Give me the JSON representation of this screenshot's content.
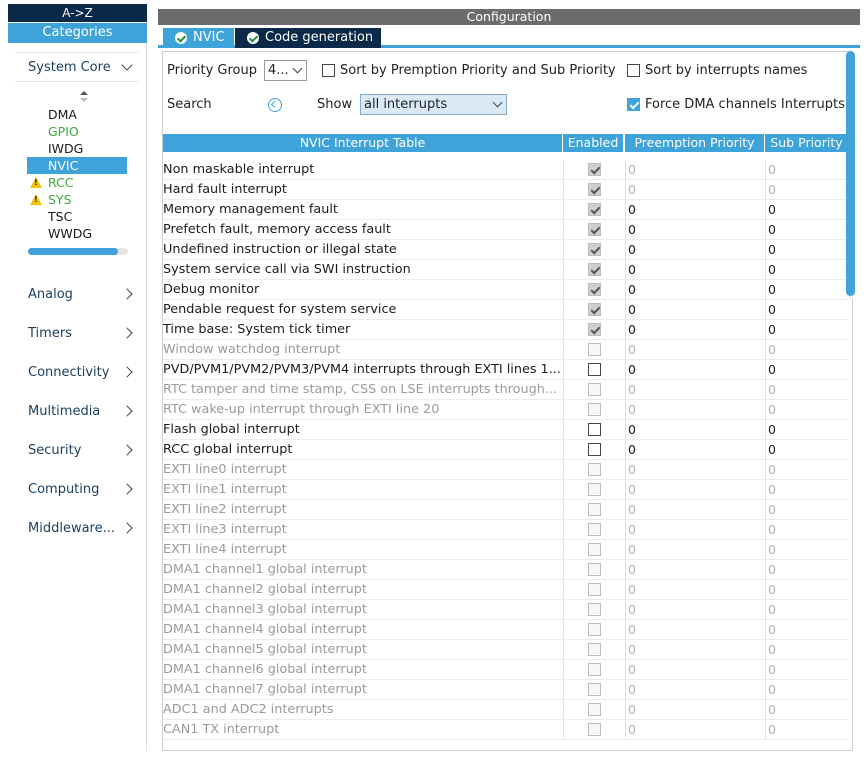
{
  "sidebar": {
    "tab_az": "A->Z",
    "tab_categories": "Categories",
    "system_core": {
      "label": "System Core",
      "items": [
        {
          "label": "DMA",
          "state": "normal"
        },
        {
          "label": "GPIO",
          "state": "configured"
        },
        {
          "label": "IWDG",
          "state": "normal"
        },
        {
          "label": "NVIC",
          "state": "selected"
        },
        {
          "label": "RCC",
          "state": "warning"
        },
        {
          "label": "SYS",
          "state": "warning"
        },
        {
          "label": "TSC",
          "state": "normal"
        },
        {
          "label": "WWDG",
          "state": "normal"
        }
      ]
    },
    "categories": [
      {
        "label": "Analog"
      },
      {
        "label": "Timers"
      },
      {
        "label": "Connectivity"
      },
      {
        "label": "Multimedia"
      },
      {
        "label": "Security"
      },
      {
        "label": "Computing"
      },
      {
        "label": "Middleware..."
      }
    ]
  },
  "main": {
    "title": "Configuration",
    "tabs": [
      {
        "label": "NVIC"
      },
      {
        "label": "Code generation"
      }
    ],
    "controls": {
      "priority_group_label": "Priority Group",
      "priority_group_value": "4...",
      "sort_premption_label": "Sort by Premption Priority and Sub Priority",
      "sort_premption_checked": false,
      "sort_names_label": "Sort by interrupts names",
      "sort_names_checked": false,
      "search_label": "Search",
      "show_label": "Show",
      "show_value": "all interrupts",
      "force_dma_label": "Force DMA channels Interrupts",
      "force_dma_checked": true
    },
    "table": {
      "headers": [
        "NVIC Interrupt Table",
        "Enabled",
        "Preemption Priority",
        "Sub Priority"
      ],
      "rows": [
        {
          "name": "Non maskable interrupt",
          "enabled": "locked",
          "preemption": "0",
          "sub": "0",
          "active": true,
          "pp_gray": true
        },
        {
          "name": "Hard fault interrupt",
          "enabled": "locked",
          "preemption": "0",
          "sub": "0",
          "active": true,
          "pp_gray": true
        },
        {
          "name": "Memory management fault",
          "enabled": "locked",
          "preemption": "0",
          "sub": "0",
          "active": true
        },
        {
          "name": "Prefetch fault, memory access fault",
          "enabled": "locked",
          "preemption": "0",
          "sub": "0",
          "active": true
        },
        {
          "name": "Undefined instruction or illegal state",
          "enabled": "locked",
          "preemption": "0",
          "sub": "0",
          "active": true
        },
        {
          "name": "System service call via SWI instruction",
          "enabled": "locked",
          "preemption": "0",
          "sub": "0",
          "active": true
        },
        {
          "name": "Debug monitor",
          "enabled": "locked",
          "preemption": "0",
          "sub": "0",
          "active": true
        },
        {
          "name": "Pendable request for system service",
          "enabled": "locked",
          "preemption": "0",
          "sub": "0",
          "active": true
        },
        {
          "name": "Time base: System tick timer",
          "enabled": "locked",
          "preemption": "0",
          "sub": "0",
          "active": true
        },
        {
          "name": "Window watchdog interrupt",
          "enabled": "disabled",
          "preemption": "0",
          "sub": "0",
          "active": false
        },
        {
          "name": "PVD/PVM1/PVM2/PVM3/PVM4 interrupts through EXTI lines 1...",
          "enabled": "off",
          "preemption": "0",
          "sub": "0",
          "active": true
        },
        {
          "name": "RTC tamper and time stamp, CSS on LSE interrupts through...",
          "enabled": "disabled",
          "preemption": "0",
          "sub": "0",
          "active": false
        },
        {
          "name": "RTC wake-up interrupt through EXTI line 20",
          "enabled": "disabled",
          "preemption": "0",
          "sub": "0",
          "active": false
        },
        {
          "name": "Flash global interrupt",
          "enabled": "off",
          "preemption": "0",
          "sub": "0",
          "active": true
        },
        {
          "name": "RCC global interrupt",
          "enabled": "off",
          "preemption": "0",
          "sub": "0",
          "active": true
        },
        {
          "name": "EXTI line0 interrupt",
          "enabled": "disabled",
          "preemption": "0",
          "sub": "0",
          "active": false
        },
        {
          "name": "EXTI line1 interrupt",
          "enabled": "disabled",
          "preemption": "0",
          "sub": "0",
          "active": false
        },
        {
          "name": "EXTI line2 interrupt",
          "enabled": "disabled",
          "preemption": "0",
          "sub": "0",
          "active": false
        },
        {
          "name": "EXTI line3 interrupt",
          "enabled": "disabled",
          "preemption": "0",
          "sub": "0",
          "active": false
        },
        {
          "name": "EXTI line4 interrupt",
          "enabled": "disabled",
          "preemption": "0",
          "sub": "0",
          "active": false
        },
        {
          "name": "DMA1 channel1 global interrupt",
          "enabled": "disabled",
          "preemption": "0",
          "sub": "0",
          "active": false
        },
        {
          "name": "DMA1 channel2 global interrupt",
          "enabled": "disabled",
          "preemption": "0",
          "sub": "0",
          "active": false
        },
        {
          "name": "DMA1 channel3 global interrupt",
          "enabled": "disabled",
          "preemption": "0",
          "sub": "0",
          "active": false
        },
        {
          "name": "DMA1 channel4 global interrupt",
          "enabled": "disabled",
          "preemption": "0",
          "sub": "0",
          "active": false
        },
        {
          "name": "DMA1 channel5 global interrupt",
          "enabled": "disabled",
          "preemption": "0",
          "sub": "0",
          "active": false
        },
        {
          "name": "DMA1 channel6 global interrupt",
          "enabled": "disabled",
          "preemption": "0",
          "sub": "0",
          "active": false
        },
        {
          "name": "DMA1 channel7 global interrupt",
          "enabled": "disabled",
          "preemption": "0",
          "sub": "0",
          "active": false
        },
        {
          "name": "ADC1 and ADC2 interrupts",
          "enabled": "disabled",
          "preemption": "0",
          "sub": "0",
          "active": false
        },
        {
          "name": "CAN1 TX interrupt",
          "enabled": "disabled",
          "preemption": "0",
          "sub": "0",
          "active": false
        }
      ]
    }
  },
  "colors": {
    "accent": "#3ea3d8",
    "dark_navy": "#0b2a4a",
    "configured_green": "#3daa3d",
    "warning_yellow": "#f3c300"
  },
  "icons": [
    "chevron-down-icon",
    "chevron-right-icon",
    "warning-icon",
    "check-circle-icon",
    "search-icon",
    "sort-arrows-icon"
  ]
}
